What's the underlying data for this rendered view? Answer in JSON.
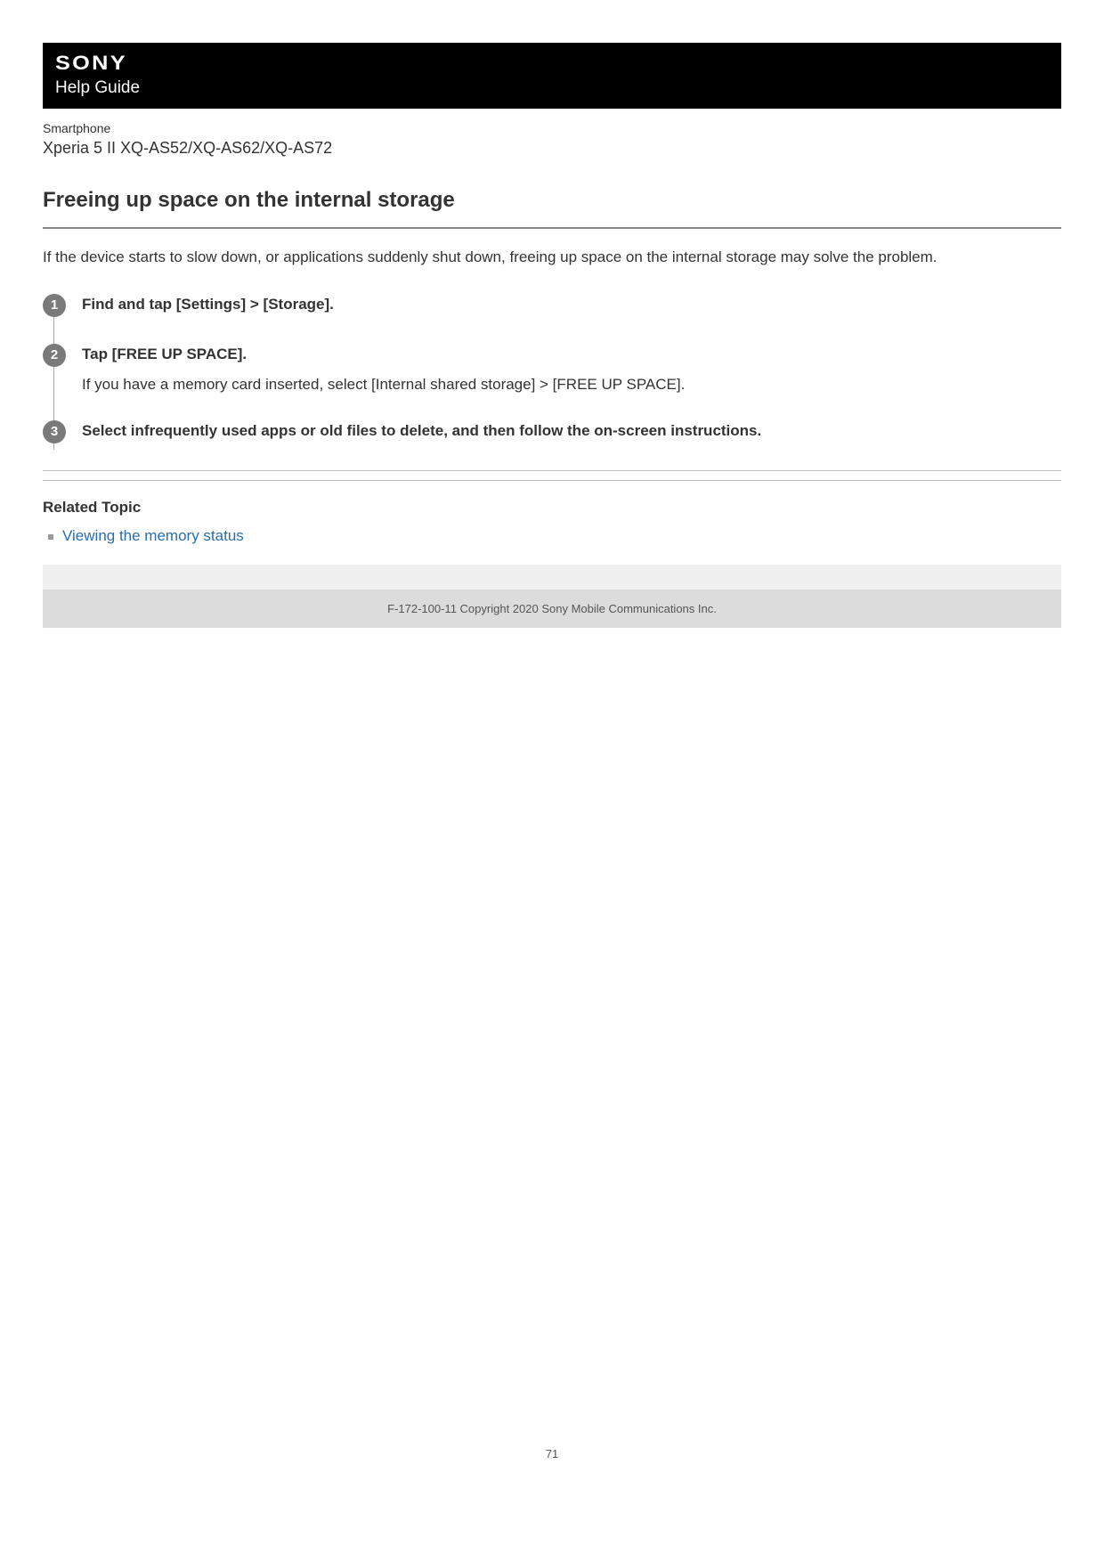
{
  "header": {
    "brand": "SONY",
    "guide_label": "Help Guide"
  },
  "product": {
    "category": "Smartphone",
    "model": "Xperia 5 II XQ-AS52/XQ-AS62/XQ-AS72"
  },
  "article": {
    "title": "Freeing up space on the internal storage",
    "intro": "If the device starts to slow down, or applications suddenly shut down, freeing up space on the internal storage may solve the problem."
  },
  "steps": [
    {
      "number": "1",
      "heading": "Find and tap [Settings] > [Storage].",
      "detail": ""
    },
    {
      "number": "2",
      "heading": "Tap [FREE UP SPACE].",
      "detail": "If you have a memory card inserted, select [Internal shared storage] > [FREE UP SPACE]."
    },
    {
      "number": "3",
      "heading": "Select infrequently used apps or old files to delete, and then follow the on-screen instructions.",
      "detail": ""
    }
  ],
  "related": {
    "heading": "Related Topic",
    "items": [
      {
        "label": "Viewing the memory status"
      }
    ]
  },
  "footer": {
    "copyright": "F-172-100-11 Copyright 2020 Sony Mobile Communications Inc."
  },
  "page_number": "71"
}
